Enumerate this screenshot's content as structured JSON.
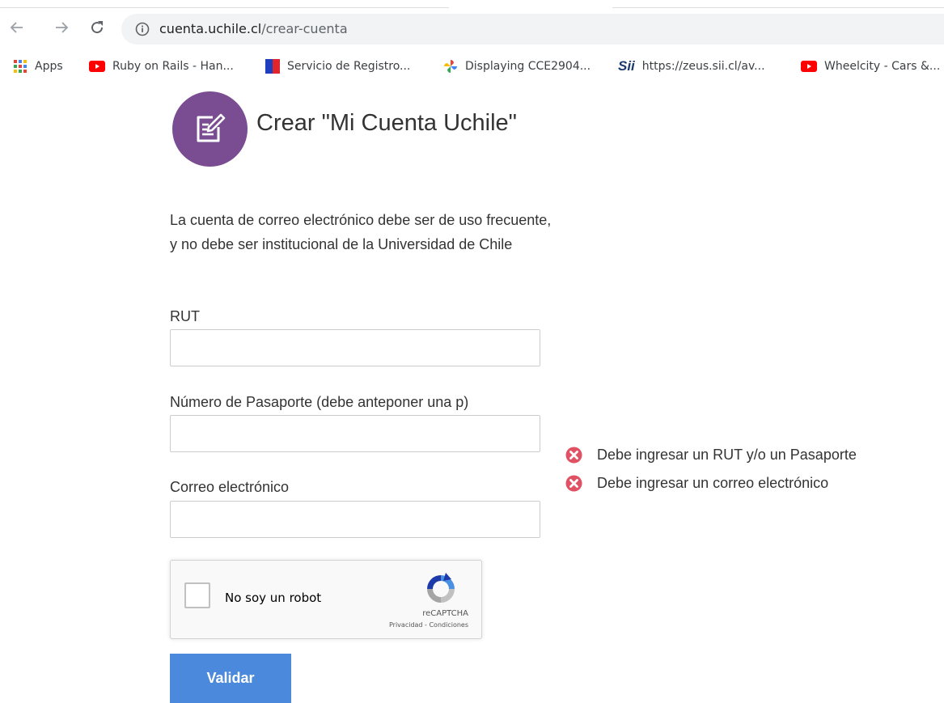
{
  "browser": {
    "url_host": "cuenta.uchile.cl",
    "url_path": "/crear-cuenta",
    "bookmarks": [
      {
        "label": "Apps",
        "icon": "apps-grid-icon"
      },
      {
        "label": "Ruby on Rails - Han...",
        "icon": "youtube-icon"
      },
      {
        "label": "Servicio de Registro...",
        "icon": "registro-civil-icon"
      },
      {
        "label": "Displaying CCE2904...",
        "icon": "google-photos-icon"
      },
      {
        "label": "https://zeus.sii.cl/av...",
        "icon": "sii-icon"
      },
      {
        "label": "Wheelcity - Cars &...",
        "icon": "youtube-icon"
      }
    ],
    "sii_text": "Sii"
  },
  "page": {
    "title": "Crear \"Mi Cuenta Uchile\"",
    "notice_line1": "La cuenta de correo electrónico debe ser de uso frecuente,",
    "notice_line2": "y no debe ser institucional de la Universidad de Chile"
  },
  "form": {
    "rut_label": "RUT",
    "rut_value": "",
    "passport_label": "Número de Pasaporte (debe anteponer una p)",
    "passport_value": "",
    "email_label": "Correo electrónico",
    "email_value": "",
    "submit_label": "Validar"
  },
  "errors": [
    "Debe ingresar un RUT y/o un Pasaporte",
    "Debe ingresar un correo electrónico"
  ],
  "recaptcha": {
    "label": "No soy un robot",
    "brand": "reCAPTCHA",
    "links": "Privacidad - Condiciones",
    "checked": false
  },
  "colors": {
    "logo_circle": "#7a4d93",
    "error_icon": "#e05263",
    "button": "#4a89dc"
  }
}
